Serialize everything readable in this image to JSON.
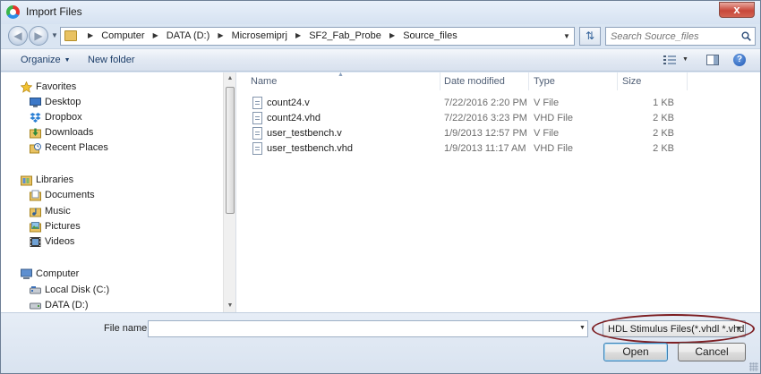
{
  "window": {
    "title": "Import Files",
    "close_label": "x"
  },
  "nav": {
    "crumbs": [
      "Computer",
      "DATA (D:)",
      "Microsemiprj",
      "SF2_Fab_Probe",
      "Source_files"
    ],
    "search_placeholder": "Search Source_files"
  },
  "toolbar": {
    "organize_label": "Organize",
    "new_folder_label": "New folder",
    "help_label": "?"
  },
  "sidebar": {
    "groups": [
      {
        "label": "Favorites",
        "icon": "star-icon",
        "items": [
          {
            "label": "Desktop",
            "icon": "desktop-icon"
          },
          {
            "label": "Dropbox",
            "icon": "dropbox-icon"
          },
          {
            "label": "Downloads",
            "icon": "downloads-icon"
          },
          {
            "label": "Recent Places",
            "icon": "recent-places-icon"
          }
        ]
      },
      {
        "label": "Libraries",
        "icon": "libraries-icon",
        "items": [
          {
            "label": "Documents",
            "icon": "documents-icon"
          },
          {
            "label": "Music",
            "icon": "music-icon"
          },
          {
            "label": "Pictures",
            "icon": "pictures-icon"
          },
          {
            "label": "Videos",
            "icon": "videos-icon"
          }
        ]
      },
      {
        "label": "Computer",
        "icon": "computer-icon",
        "items": [
          {
            "label": "Local Disk (C:)",
            "icon": "drive-icon"
          },
          {
            "label": "DATA (D:)",
            "icon": "drive-icon"
          }
        ]
      }
    ]
  },
  "filelist": {
    "columns": {
      "name": "Name",
      "date": "Date modified",
      "type": "Type",
      "size": "Size"
    },
    "rows": [
      {
        "name": "count24.v",
        "date": "7/22/2016 2:20 PM",
        "type": "V File",
        "size": "1 KB"
      },
      {
        "name": "count24.vhd",
        "date": "7/22/2016 3:23 PM",
        "type": "VHD File",
        "size": "2 KB"
      },
      {
        "name": "user_testbench.v",
        "date": "1/9/2013 12:57 PM",
        "type": "V File",
        "size": "2 KB"
      },
      {
        "name": "user_testbench.vhd",
        "date": "1/9/2013 11:17 AM",
        "type": "VHD File",
        "size": "2 KB"
      }
    ]
  },
  "bottom": {
    "file_name_label": "File name:",
    "file_name_value": "",
    "filter_selected": "HDL Stimulus Files(*.vhdl *.vhd",
    "open_label": "Open",
    "cancel_label": "Cancel"
  },
  "colors": {
    "highlight_ellipse": "#7d1e22",
    "accent": "#1e3f6a"
  }
}
